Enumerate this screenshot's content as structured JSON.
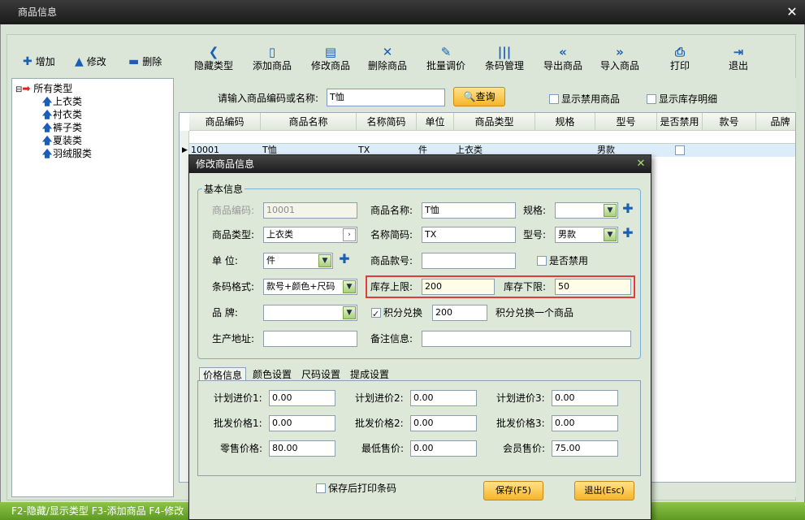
{
  "window": {
    "title": "商品信息",
    "close": "✕"
  },
  "left_toolbar": {
    "add": "增加",
    "edit": "修改",
    "delete": "删除"
  },
  "tree": {
    "root": "所有类型",
    "items": [
      "上衣类",
      "衬衣类",
      "裤子类",
      "夏装类",
      "羽绒服类"
    ]
  },
  "toolbar": [
    {
      "icon": "chevron-left-icon",
      "glyph": "❮",
      "label": "隐藏类型"
    },
    {
      "icon": "file-add-icon",
      "glyph": "▯",
      "label": "添加商品"
    },
    {
      "icon": "file-edit-icon",
      "glyph": "▤",
      "label": "修改商品"
    },
    {
      "icon": "delete-x-icon",
      "glyph": "✕",
      "label": "删除商品"
    },
    {
      "icon": "price-tag-icon",
      "glyph": "✎",
      "label": "批量调价"
    },
    {
      "icon": "barcode-icon",
      "glyph": "|||",
      "label": "条码管理"
    },
    {
      "icon": "double-left-icon",
      "glyph": "«",
      "label": "导出商品"
    },
    {
      "icon": "double-right-icon",
      "glyph": "»",
      "label": "导入商品"
    },
    {
      "icon": "printer-icon",
      "glyph": "⎙",
      "label": "打印"
    },
    {
      "icon": "exit-icon",
      "glyph": "⇥",
      "label": "退出"
    }
  ],
  "search": {
    "label": "请输入商品编码或名称:",
    "value": "T恤",
    "query_button": "查询",
    "show_disabled": "显示禁用商品",
    "show_stock_detail": "显示库存明细"
  },
  "grid": {
    "columns": [
      "商品编码",
      "商品名称",
      "名称简码",
      "单位",
      "商品类型",
      "规格",
      "型号",
      "是否禁用",
      "款号",
      "品牌"
    ],
    "rows": [
      {
        "code": "10001",
        "name": "T恤",
        "short": "TX",
        "unit": "件",
        "type": "上衣类",
        "spec": "",
        "model": "男款"
      }
    ]
  },
  "status_bar": "F2-隐藏/显示类型  F3-添加商品  F4-修改",
  "dialog": {
    "title": "修改商品信息",
    "close": "✕",
    "basic_legend": "基本信息",
    "labels": {
      "code": "商品编码:",
      "name": "商品名称:",
      "spec": "规格:",
      "type": "商品类型:",
      "short": "名称简码:",
      "model": "型号:",
      "unit": "单    位:",
      "style_no": "商品款号:",
      "disabled": "是否禁用",
      "barcode_format": "条码格式:",
      "stock_upper": "库存上限:",
      "stock_lower": "库存下限:",
      "brand": "品    牌:",
      "points": "积分兑换",
      "points_desc": "积分兑换一个商品",
      "origin": "生产地址:",
      "remarks": "备注信息:"
    },
    "values": {
      "code": "10001",
      "name": "T恤",
      "spec": "",
      "type": "上衣类",
      "short": "TX",
      "model": "男款",
      "unit": "件",
      "style_no": "",
      "barcode_format": "款号+颜色+尺码",
      "stock_upper": "200",
      "stock_lower": "50",
      "brand": "",
      "points": "200",
      "origin": "",
      "remarks": ""
    },
    "tabs": [
      "价格信息",
      "颜色设置",
      "尺码设置",
      "提成设置"
    ],
    "price_labels": {
      "plan1": "计划进价1:",
      "plan2": "计划进价2:",
      "plan3": "计划进价3:",
      "wholesale1": "批发价格1:",
      "wholesale2": "批发价格2:",
      "wholesale3": "批发价格3:",
      "retail": "零售价格:",
      "min": "最低售价:",
      "member": "会员售价:"
    },
    "price_values": {
      "plan1": "0.00",
      "plan2": "0.00",
      "plan3": "0.00",
      "wholesale1": "0.00",
      "wholesale2": "0.00",
      "wholesale3": "0.00",
      "retail": "80.00",
      "min": "0.00",
      "member": "75.00"
    },
    "print_after_save": "保存后打印条码",
    "save_button": "保存(F5)",
    "exit_button": "退出(Esc)"
  },
  "colors": {
    "accent_blue": "#1a5fb4",
    "highlight_red": "#e23b3b",
    "button_orange": "#f6b42a",
    "status_green": "#6ea82f"
  }
}
